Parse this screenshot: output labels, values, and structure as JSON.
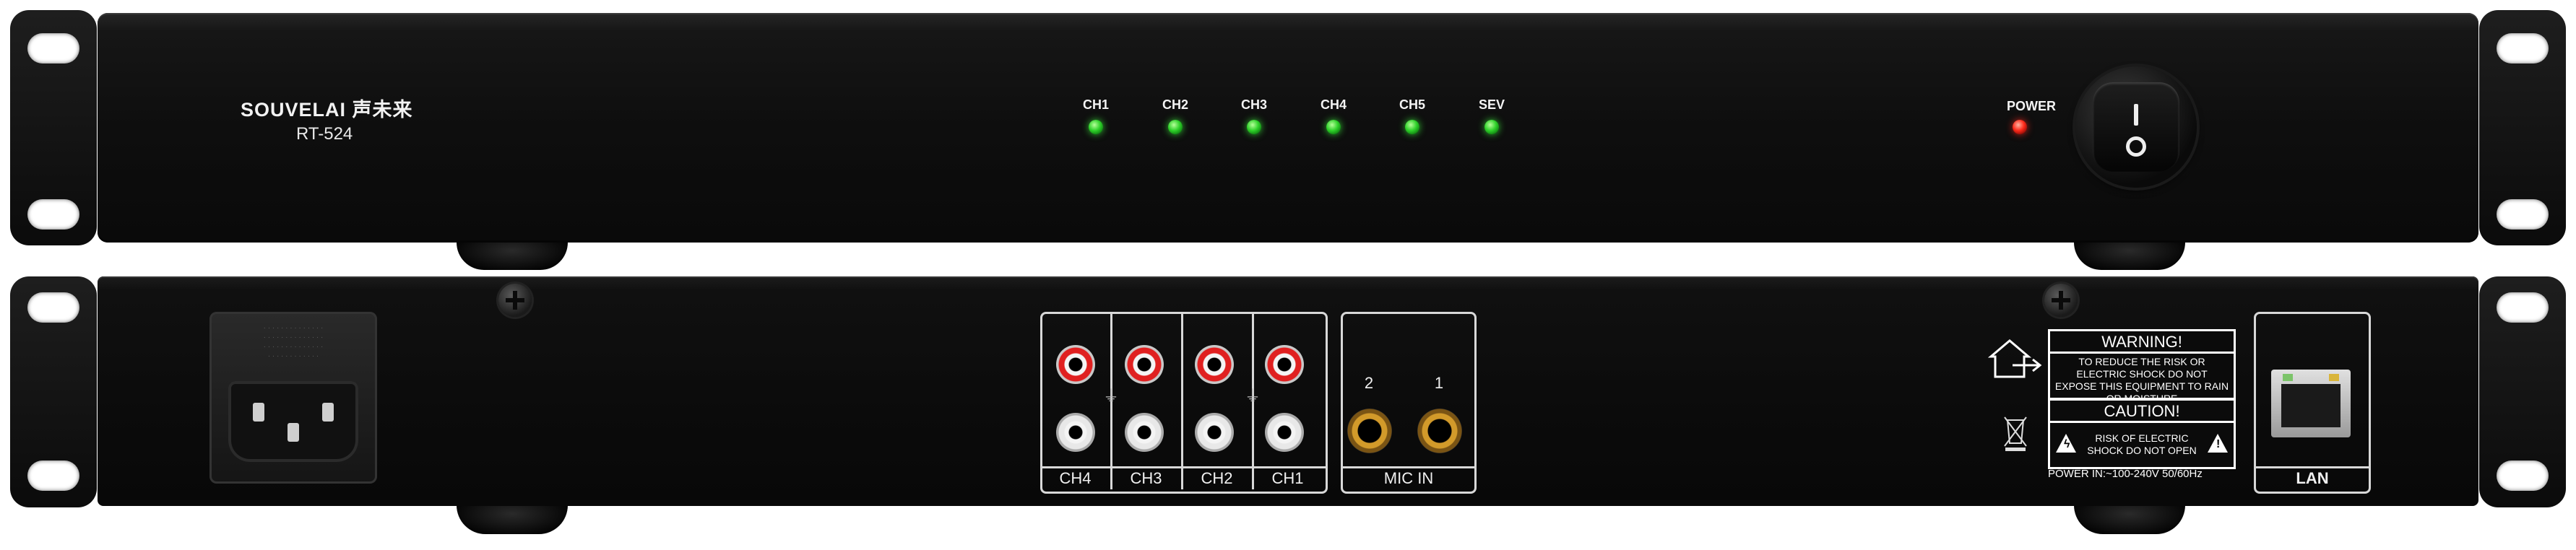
{
  "front_panel": {
    "brand": "SOUVELAI 声未来",
    "model": "RT-524",
    "channels": [
      {
        "label": "CH1",
        "led": "green"
      },
      {
        "label": "CH2",
        "led": "green"
      },
      {
        "label": "CH3",
        "led": "green"
      },
      {
        "label": "CH4",
        "led": "green"
      },
      {
        "label": "CH5",
        "led": "green"
      },
      {
        "label": "SEV",
        "led": "green"
      }
    ],
    "power_label": "POWER",
    "power_led": "red",
    "switch_icon": "power-rocker-switch-icon"
  },
  "rear_panel": {
    "rca_channels": [
      "CH4",
      "CH3",
      "CH2",
      "CH1"
    ],
    "mic_labels": [
      "2",
      "1"
    ],
    "mic_in_label": "MIC IN",
    "warning": {
      "title": "WARNING!",
      "text": "TO REDUCE THE RISK OR ELECTRIC SHOCK DO NOT EXPOSE THIS EQUIPMENT TO RAIN OR MOISTURE"
    },
    "caution": {
      "title": "CAUTION!",
      "text": "RISK OF ELECTRIC SHOCK DO NOT OPEN"
    },
    "power_in": "POWER IN:~100-240V 50/60Hz",
    "lan_label": "LAN",
    "icons": [
      "indoor-use-icon",
      "weee-bin-icon",
      "ground-icon",
      "screw-icon"
    ]
  },
  "colors": {
    "chassis": "#0e0e0e",
    "led_green": "#2fd12a",
    "led_red": "#ff2a1a",
    "rca_red": "#e02020",
    "jack_gold": "#d29a2a"
  }
}
